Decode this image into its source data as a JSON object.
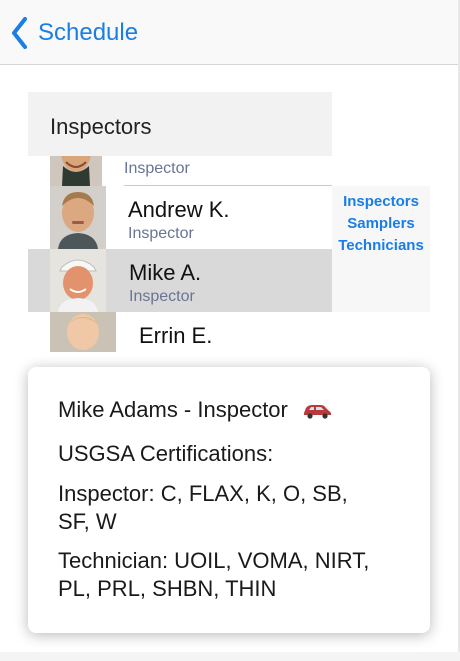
{
  "nav": {
    "back_label": "Schedule"
  },
  "section": {
    "title": "Inspectors"
  },
  "people": [
    {
      "name": "",
      "role": "Inspector"
    },
    {
      "name": "Andrew K.",
      "role": "Inspector"
    },
    {
      "name": "Mike A.",
      "role": "Inspector"
    },
    {
      "name": "Errin E.",
      "role": ""
    }
  ],
  "index_links": [
    "Inspectors",
    "Samplers",
    "Technicians"
  ],
  "popup": {
    "title": "Mike Adams - Inspector",
    "title_icon": "car-icon",
    "certs_heading": "USGSA Certifications:",
    "inspector_line1": "Inspector: C, FLAX, K, O, SB,",
    "inspector_line2": "SF, W",
    "technician_line1": "Technician: UOIL, VOMA, NIRT,",
    "technician_line2": "PL, PRL, SHBN, THIN"
  },
  "colors": {
    "accent": "#1a7ee6",
    "selected_row": "#d9d9d9",
    "header_bg": "#f2f2f3",
    "car": "#b83a3a"
  }
}
